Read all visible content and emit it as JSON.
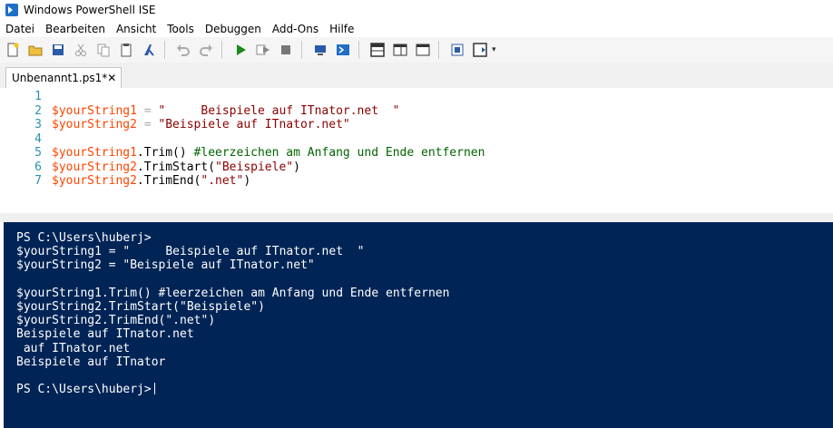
{
  "window": {
    "title": "Windows PowerShell ISE"
  },
  "menu": [
    "Datei",
    "Bearbeiten",
    "Ansicht",
    "Tools",
    "Debuggen",
    "Add-Ons",
    "Hilfe"
  ],
  "toolbar": {
    "icons": [
      "new-file-icon",
      "open-file-icon",
      "save-icon",
      "cut-icon",
      "copy-icon",
      "paste-icon",
      "clear-console-icon",
      "undo-icon",
      "redo-icon",
      "run-icon",
      "run-selection-icon",
      "stop-icon",
      "remote-powershell-icon",
      "powershell-console-icon",
      "show-script-top-icon",
      "show-script-right-icon",
      "show-script-max-icon",
      "show-command-window-icon",
      "show-command-addon-icon"
    ]
  },
  "tab": {
    "label": "Unbenannt1.ps1*",
    "close": "✕"
  },
  "editor": {
    "lines": [
      {
        "num": "1",
        "tokens": []
      },
      {
        "num": "2",
        "tokens": [
          {
            "t": "$yourString1",
            "c": "var"
          },
          {
            "t": " = ",
            "c": "op"
          },
          {
            "t": "\"     Beispiele auf ITnator.net  \"",
            "c": "str"
          }
        ]
      },
      {
        "num": "3",
        "tokens": [
          {
            "t": "$yourString2",
            "c": "var"
          },
          {
            "t": " = ",
            "c": "op"
          },
          {
            "t": "\"Beispiele auf ITnator.net\"",
            "c": "str"
          }
        ]
      },
      {
        "num": "4",
        "tokens": []
      },
      {
        "num": "5",
        "tokens": [
          {
            "t": "$yourString1",
            "c": "var"
          },
          {
            "t": ".Trim() ",
            "c": "mem"
          },
          {
            "t": "#leerzeichen am Anfang und Ende entfernen",
            "c": "cmt"
          }
        ]
      },
      {
        "num": "6",
        "tokens": [
          {
            "t": "$yourString2",
            "c": "var"
          },
          {
            "t": ".TrimStart(",
            "c": "mem"
          },
          {
            "t": "\"Beispiele\"",
            "c": "str"
          },
          {
            "t": ")",
            "c": "mem"
          }
        ]
      },
      {
        "num": "7",
        "tokens": [
          {
            "t": "$yourString2",
            "c": "var"
          },
          {
            "t": ".TrimEnd(",
            "c": "mem"
          },
          {
            "t": "\".net\"",
            "c": "str"
          },
          {
            "t": ")",
            "c": "mem"
          }
        ]
      }
    ]
  },
  "console": {
    "lines": [
      "PS C:\\Users\\huberj>",
      "$yourString1 = \"     Beispiele auf ITnator.net  \"",
      "$yourString2 = \"Beispiele auf ITnator.net\"",
      "",
      "$yourString1.Trim() #leerzeichen am Anfang und Ende entfernen",
      "$yourString2.TrimStart(\"Beispiele\")",
      "$yourString2.TrimEnd(\".net\")",
      "Beispiele auf ITnator.net",
      " auf ITnator.net",
      "Beispiele auf ITnator",
      "",
      "PS C:\\Users\\huberj>"
    ]
  },
  "colors": {
    "console_bg": "#012456",
    "variable": "#ff4500",
    "string": "#8b0000",
    "comment": "#006400",
    "line_number": "#2b91af"
  }
}
